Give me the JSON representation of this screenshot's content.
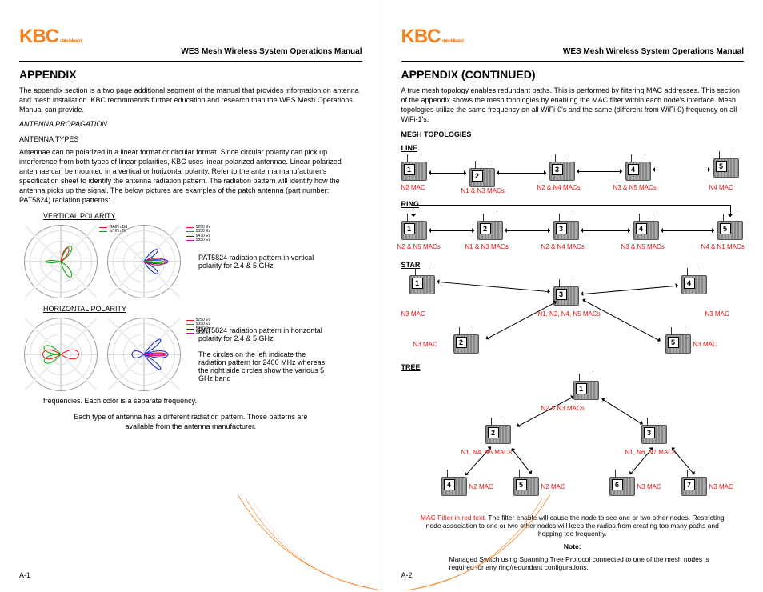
{
  "brand": {
    "name": "KBC",
    "tagline": "data delivered"
  },
  "header": {
    "title": "WES Mesh Wireless System Operations Manual"
  },
  "left": {
    "h1": "APPENDIX",
    "intro": "The appendix section is a two page additional segment of the manual that provides information on antenna and mesh installation. KBC recommends further education and research than the WES Mesh Operations Manual can provide.",
    "sec1": "ANTENNA PROPAGATION",
    "sec2": "ANTENNA TYPES",
    "body": "Antennae can be polarized in a linear format or circular format. Since circular polarity can pick up interference from both types of linear polarities, KBC uses linear polarized antennae. Linear polarized antennae can be mounted in a vertical or horizontal polarity. Refer to the antenna manufacturer's specification sheet to identify the antenna radiation pattern. The radiation pattern will identify how the antenna picks up the signal. The below pictures are examples of the patch antenna (part number: PAT5824) radiation patterns:",
    "vpol": "VERTICAL POLARITY",
    "vpol_cap": "PAT5824 radiation pattern in vertical polarity for 2.4 & 5 GHz.",
    "hpol": "HORIZONTAL POLARITY",
    "hpol_cap": "PAT5824 radiation pattern in horizontal polarity for 2.4 & 5 GHz.",
    "hpol_cap2": "The circles on the left indicate the radiation pattern for 2400 MHz whereas the right side circles show the various 5 GHz band",
    "freq_note": "frequencies. Each color is a separate frequency.",
    "closing": "Each type of antenna has a different radiation pattern. Those patterns are available from the antenna manufacturer.",
    "pagenum": "A-1"
  },
  "right": {
    "h1": "APPENDIX (CONTINUED)",
    "intro": "A true mesh topology enables redundant paths. This is performed by filtering MAC addresses. This section of the appendix shows the mesh topologies by enabling the MAC filter within each node's interface. Mesh topologies utilize the same frequency on all WiFi-0's and the same (different from WiFi-0) frequency on all WiFi-1's.",
    "topos": "MESH TOPOLOGIES",
    "line": "LINE",
    "ring": "RING",
    "star": "STAR",
    "tree": "TREE",
    "line_macs": [
      "N2 MAC",
      "N1 & N3 MACs",
      "N2 & N4 MACs",
      "N3 & N5 MACs",
      "N4 MAC"
    ],
    "ring_macs": [
      "N2 & N5 MACs",
      "N1 & N3 MACs",
      "N2 & N4 MACs",
      "N3 & N5 MACs",
      "N4 & N1 MACs"
    ],
    "star_macs": {
      "n1": "N3 MAC",
      "n2": "N3 MAC",
      "n3": "N1, N2, N4, N5 MACs",
      "n4": "N3 MAC",
      "n5": "N3 MAC"
    },
    "tree_macs": {
      "n1": "N2 & N3 MACs",
      "n2": "N1, N4, N5 MACs",
      "n3": "N1, N6, N7 MACs",
      "n4": "N2 MAC",
      "n5": "N2 MAC",
      "n6": "N3 MAC",
      "n7": "N3 MAC"
    },
    "note1a": "MAC Filter in red text.",
    "note1b": " The filter enable will cause the node to see one or two other nodes. Restricting node association to one or two other nodes will keep the radios from creating too many paths and hopping too frequently.",
    "note_hdr": "Note:",
    "note2": "Managed Switch using Spanning Tree Protocol connected to one of the mesh nodes is required for any ring/redundant configurations.",
    "pagenum": "A-2"
  },
  "nodes": [
    "1",
    "2",
    "3",
    "4",
    "5",
    "6",
    "7"
  ]
}
